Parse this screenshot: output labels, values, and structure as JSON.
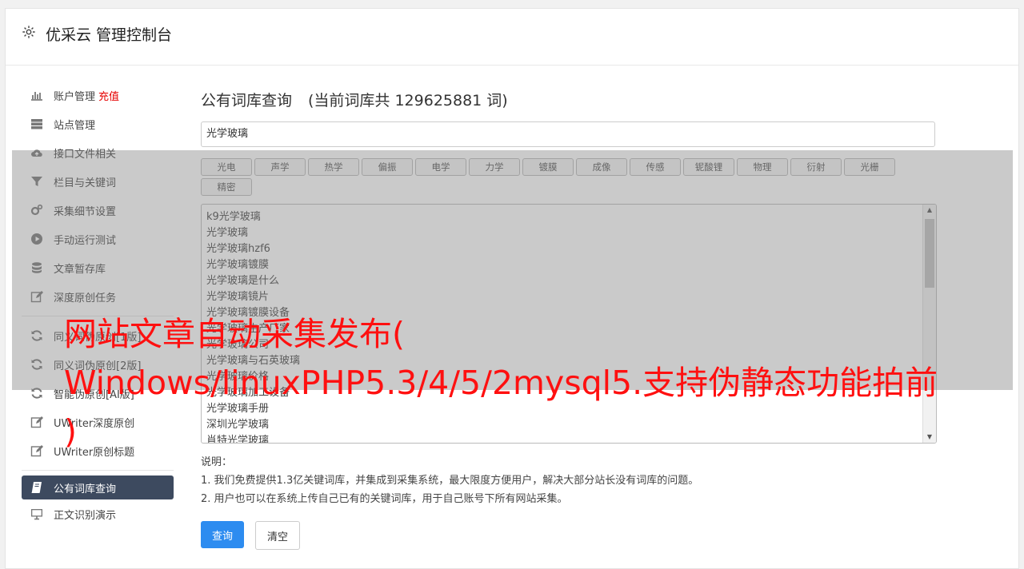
{
  "header": {
    "title": "优采云 管理控制台",
    "icon": "gear-icon"
  },
  "sidebar": {
    "items": [
      {
        "label": "账户管理",
        "badge": "充值",
        "icon": "bar-chart-icon"
      },
      {
        "label": "站点管理",
        "icon": "server-icon"
      },
      {
        "label": "接口文件相关",
        "icon": "cloud-upload-icon"
      },
      {
        "label": "栏目与关键词",
        "icon": "filter-icon"
      },
      {
        "label": "采集细节设置",
        "icon": "gears-icon"
      },
      {
        "label": "手动运行测试",
        "icon": "play-circle-icon"
      },
      {
        "label": "文章暂存库",
        "icon": "database-icon"
      },
      {
        "label": "深度原创任务",
        "icon": "edit-icon"
      },
      {
        "label": "同义词伪原创[1版]",
        "icon": "refresh-icon"
      },
      {
        "label": "同义词伪原创[2版]",
        "icon": "refresh-icon"
      },
      {
        "label": "智能伪原创[AI版]",
        "icon": "refresh-icon"
      },
      {
        "label": "UWriter深度原创",
        "icon": "edit-icon"
      },
      {
        "label": "UWriter原创标题",
        "icon": "edit-icon"
      },
      {
        "label": "公有词库查询",
        "icon": "book-icon",
        "active": true
      },
      {
        "label": "正文识别演示",
        "icon": "monitor-icon"
      }
    ]
  },
  "main": {
    "title": "公有词库查询",
    "count_text": "(当前词库共 129625881 词)",
    "query_value": "光学玻璃",
    "tags": [
      "光电",
      "声学",
      "热学",
      "偏振",
      "电学",
      "力学",
      "镀膜",
      "成像",
      "传感",
      "铌酸锂",
      "物理",
      "衍射",
      "光栅",
      "精密"
    ],
    "results": [
      "k9光学玻璃",
      "光学玻璃",
      "光学玻璃hzf6",
      "光学玻璃镀膜",
      "光学玻璃是什么",
      "光学玻璃镜片",
      "光学玻璃镀膜设备",
      "光学玻璃生产厂家",
      "光学玻璃公司",
      "光学玻璃与石英玻璃",
      "光学玻璃价格",
      "光学玻璃加工设备",
      "光学玻璃手册",
      "深圳光学玻璃",
      "肖特光学玻璃"
    ],
    "notes_title": "说明：",
    "notes": [
      "1. 我们免费提供1.3亿关键词库，并集成到采集系统，最大限度方便用户，解决大部分站长没有词库的问题。",
      "2. 用户也可以在系统上传自己已有的关键词库，用于自己账号下所有网站采集。"
    ],
    "query_button": "查询",
    "clear_button": "清空"
  },
  "watermark": {
    "line1": "网站文章自动采集发布(",
    "line2": "Windows/linuxPHP5.3/4/5/2mysql5.支持伪静态功能拍前",
    "line3": ")"
  },
  "colors": {
    "accent": "#2d8cf0",
    "active_nav": "#3d4a5f",
    "watermark": "#ff1010",
    "recharge": "#e60000"
  }
}
